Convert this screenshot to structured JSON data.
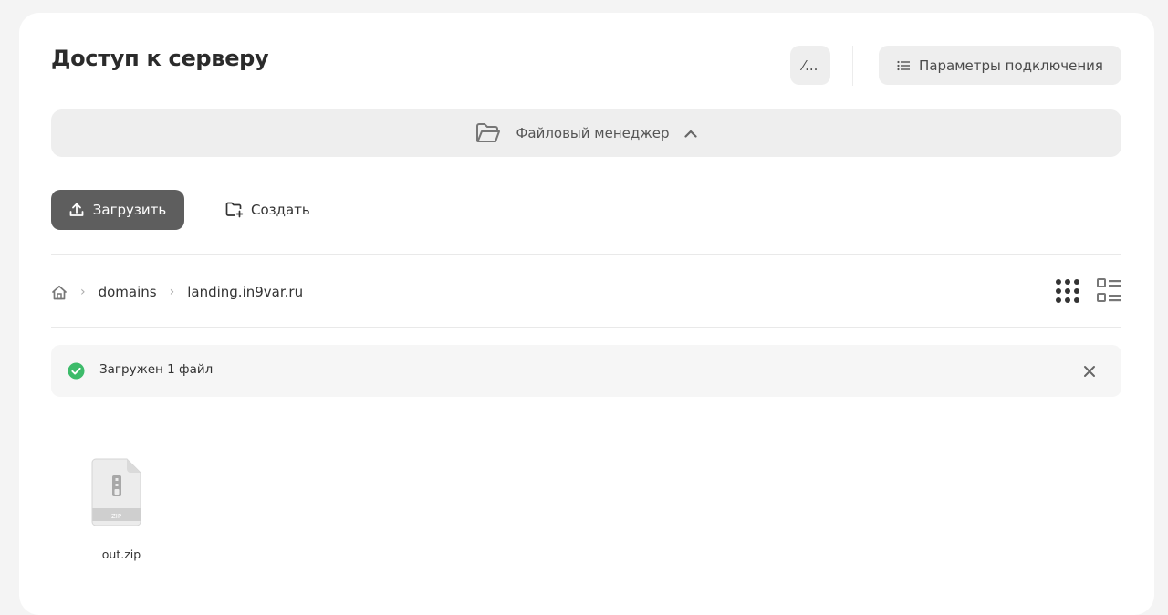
{
  "header": {
    "title": "Доступ к серверу",
    "edit_label": "⁄...",
    "params_label": "Параметры подключения"
  },
  "file_manager": {
    "label": "Файловый менеджер"
  },
  "toolbar": {
    "upload_label": "Загрузить",
    "create_label": "Создать"
  },
  "breadcrumb": {
    "items": [
      "domains",
      "landing.in9var.ru"
    ]
  },
  "alert": {
    "text": "Загружен 1 файл",
    "color": "#3dbb6a"
  },
  "files": [
    {
      "name": "out.zip",
      "type_label": "ZIP"
    }
  ],
  "colors": {
    "primary_button": "#5e5e5e",
    "surface": "#eeeeee"
  }
}
